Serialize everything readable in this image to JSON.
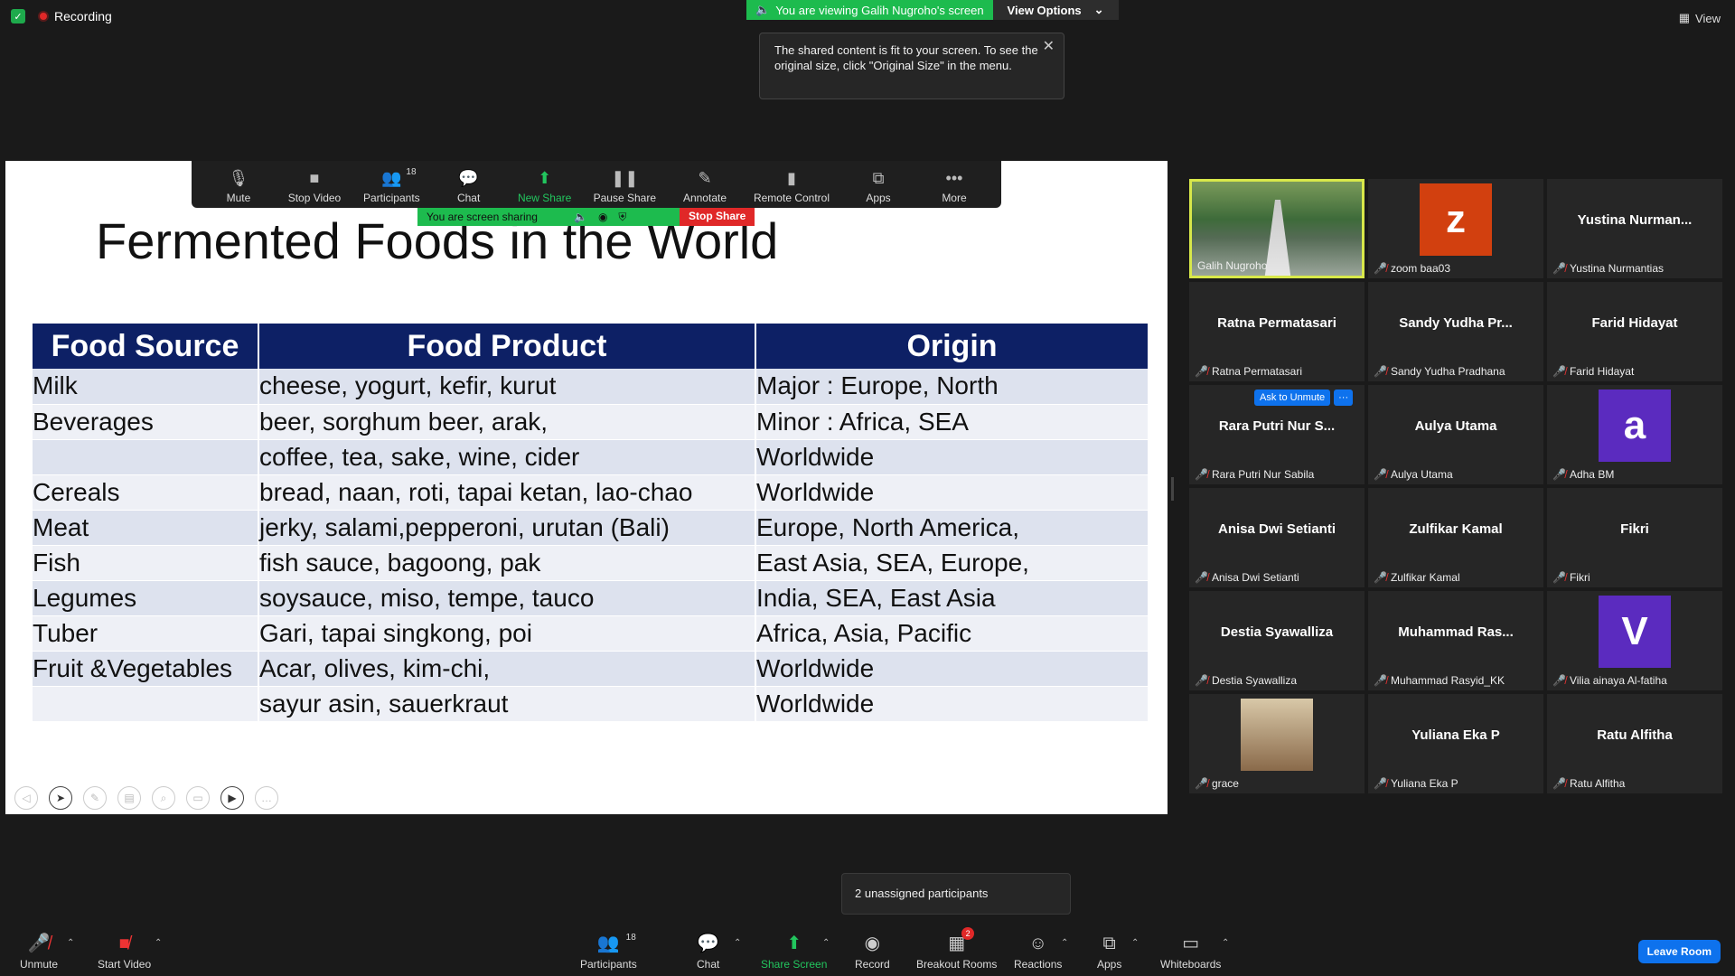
{
  "top": {
    "recording_label": "Recording",
    "view_label": "View"
  },
  "banner": {
    "viewing_text": "You are viewing Galih Nugroho's screen",
    "view_options": "View Options"
  },
  "tooltip": {
    "text": "The shared content is fit to your screen. To see the original size, click \"Original Size\" in the menu."
  },
  "share_toolbar": {
    "items": [
      {
        "label": "Mute",
        "icon": "mic-icon"
      },
      {
        "label": "Stop Video",
        "icon": "video-icon"
      },
      {
        "label": "Participants",
        "icon": "participants-icon",
        "count": "18"
      },
      {
        "label": "Chat",
        "icon": "chat-icon"
      },
      {
        "label": "New Share",
        "icon": "share-icon"
      },
      {
        "label": "Pause Share",
        "icon": "pause-icon"
      },
      {
        "label": "Annotate",
        "icon": "pen-icon"
      },
      {
        "label": "Remote Control",
        "icon": "mouse-icon"
      },
      {
        "label": "Apps",
        "icon": "apps-icon"
      },
      {
        "label": "More",
        "icon": "more-icon"
      }
    ],
    "sharing_text": "You are screen sharing",
    "stop_share": "Stop Share"
  },
  "slide": {
    "title": "Fermented Foods in the World",
    "headers": [
      "Food Source",
      "Food Product",
      "Origin"
    ],
    "rows": [
      [
        "Milk",
        "cheese, yogurt, kefir, kurut",
        "Major  : Europe, North"
      ],
      [
        "Beverages",
        "beer, sorghum beer, arak,",
        "Minor : Africa, SEA"
      ],
      [
        "",
        "coffee, tea, sake, wine, cider",
        "Worldwide"
      ],
      [
        "Cereals",
        "bread, naan, roti, tapai ketan, lao-chao",
        "Worldwide"
      ],
      [
        "Meat",
        "jerky, salami,pepperoni, urutan (Bali)",
        "Europe, North America,"
      ],
      [
        "Fish",
        "fish sauce, bagoong, pak",
        "East Asia, SEA, Europe,"
      ],
      [
        "Legumes",
        "soysauce, miso, tempe, tauco",
        "India, SEA, East Asia"
      ],
      [
        "Tuber",
        "Gari, tapai singkong, poi",
        "Africa, Asia, Pacific"
      ],
      [
        "Fruit &Vegetables",
        "Acar, olives, kim-chi,",
        "Worldwide"
      ],
      [
        "",
        "sayur asin, sauerkraut",
        "Worldwide"
      ]
    ]
  },
  "gallery": {
    "tiles": [
      {
        "display": "",
        "footer": "Galih Nugroho",
        "type": "photo-bridge",
        "muted": false
      },
      {
        "display": "z",
        "footer": "zoom baa03",
        "type": "avatar",
        "color": "#d2400f",
        "muted": true
      },
      {
        "display": "Yustina  Nurman...",
        "footer": "Yustina Nurmantias",
        "type": "name",
        "muted": true
      },
      {
        "display": "Ratna Permatasari",
        "footer": "Ratna Permatasari",
        "type": "name",
        "muted": true
      },
      {
        "display": "Sandy  Yudha  Pr...",
        "footer": "Sandy Yudha Pradhana",
        "type": "name",
        "muted": true
      },
      {
        "display": "Farid Hidayat",
        "footer": "Farid Hidayat",
        "type": "name",
        "muted": true
      },
      {
        "display": "Rara Putri Nur S...",
        "footer": "Rara Putri Nur Sabila",
        "type": "name",
        "muted": true,
        "ask": true
      },
      {
        "display": "Aulya Utama",
        "footer": "Aulya Utama",
        "type": "name",
        "muted": true
      },
      {
        "display": "a",
        "footer": "Adha BM",
        "type": "avatar",
        "color": "#5b2bbf",
        "muted": true
      },
      {
        "display": "Anisa Dwi Setianti",
        "footer": "Anisa Dwi Setianti",
        "type": "name",
        "muted": true
      },
      {
        "display": "Zulfikar Kamal",
        "footer": "Zulfikar Kamal",
        "type": "name",
        "muted": true
      },
      {
        "display": "Fikri",
        "footer": "Fikri",
        "type": "name",
        "muted": true
      },
      {
        "display": "Destia Syawalliza",
        "footer": "Destia Syawalliza",
        "type": "name",
        "muted": true
      },
      {
        "display": "Muhammad  Ras...",
        "footer": "Muhammad Rasyid_KK",
        "type": "name",
        "muted": true
      },
      {
        "display": "V",
        "footer": "Vilia ainaya Al-fatiha",
        "type": "avatar",
        "color": "#5b2bbf",
        "muted": true
      },
      {
        "display": "",
        "footer": "grace",
        "type": "photo-grace",
        "muted": true
      },
      {
        "display": "Yuliana Eka P",
        "footer": "Yuliana Eka P",
        "type": "name",
        "muted": true
      },
      {
        "display": "Ratu Alfitha",
        "footer": "Ratu Alfitha",
        "type": "name",
        "muted": true
      }
    ],
    "ask_to_unmute": "Ask to Unmute",
    "more": "···"
  },
  "unassigned": "2 unassigned participants",
  "bottom": {
    "unmute": "Unmute",
    "start_video": "Start Video",
    "participants": "Participants",
    "participants_count": "18",
    "chat": "Chat",
    "share_screen": "Share Screen",
    "record": "Record",
    "breakout": "Breakout Rooms",
    "breakout_badge": "2",
    "reactions": "Reactions",
    "apps": "Apps",
    "whiteboards": "Whiteboards",
    "leave": "Leave Room"
  }
}
